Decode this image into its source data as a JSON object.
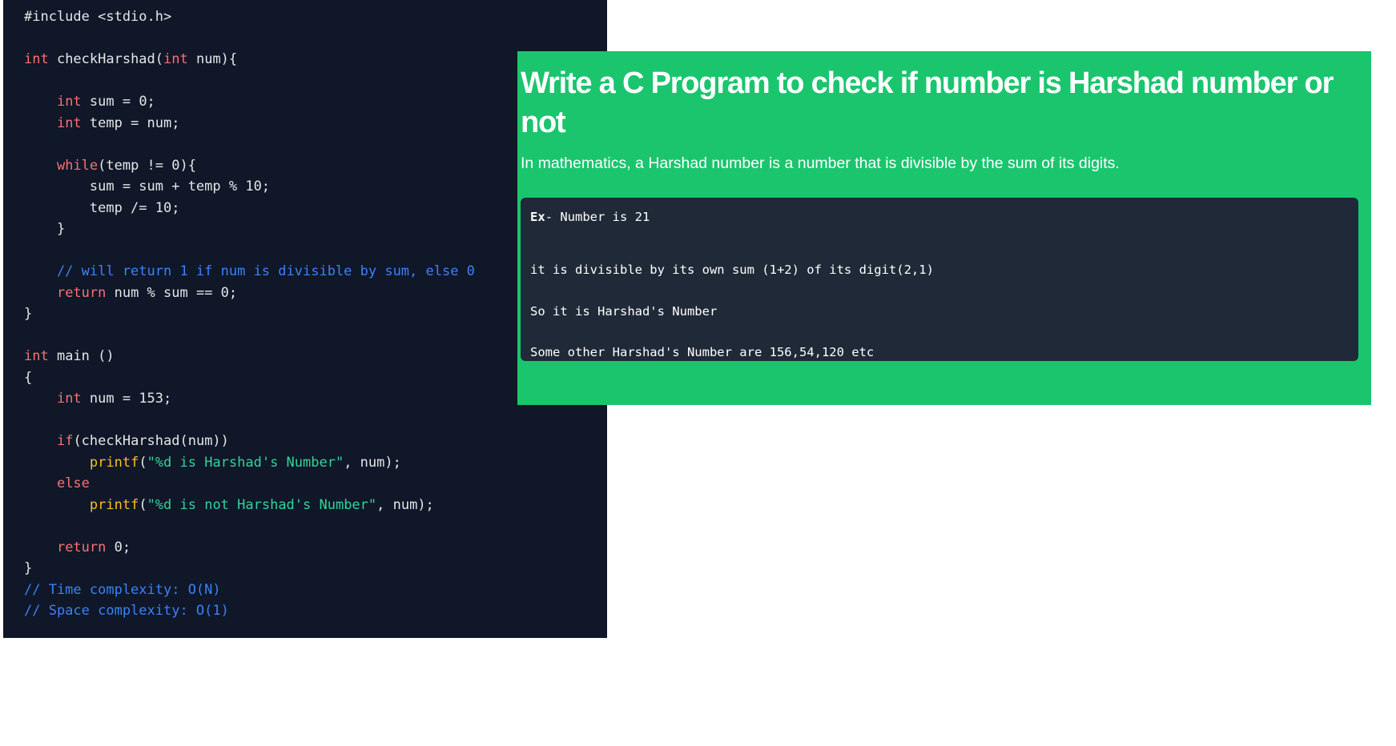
{
  "code": {
    "lines": [
      [
        {
          "t": "#include <stdio.h>",
          "c": "plain"
        }
      ],
      [],
      [
        {
          "t": "int",
          "c": "keyword"
        },
        {
          "t": " checkHarshad(",
          "c": "plain"
        },
        {
          "t": "int",
          "c": "keyword"
        },
        {
          "t": " num){",
          "c": "plain"
        }
      ],
      [],
      [
        {
          "t": "    ",
          "c": "plain"
        },
        {
          "t": "int",
          "c": "keyword"
        },
        {
          "t": " sum = 0;",
          "c": "plain"
        }
      ],
      [
        {
          "t": "    ",
          "c": "plain"
        },
        {
          "t": "int",
          "c": "keyword"
        },
        {
          "t": " temp = num;",
          "c": "plain"
        }
      ],
      [],
      [
        {
          "t": "    ",
          "c": "plain"
        },
        {
          "t": "while",
          "c": "keyword"
        },
        {
          "t": "(temp != 0){",
          "c": "plain"
        }
      ],
      [
        {
          "t": "        sum = sum + temp % 10;",
          "c": "plain"
        }
      ],
      [
        {
          "t": "        temp /= 10;",
          "c": "plain"
        }
      ],
      [
        {
          "t": "    }",
          "c": "plain"
        }
      ],
      [],
      [
        {
          "t": "    // will return 1 if num is divisible by sum, else 0",
          "c": "comment"
        }
      ],
      [
        {
          "t": "    ",
          "c": "plain"
        },
        {
          "t": "return",
          "c": "keyword"
        },
        {
          "t": " num % sum == 0;",
          "c": "plain"
        }
      ],
      [
        {
          "t": "}",
          "c": "plain"
        }
      ],
      [],
      [
        {
          "t": "int",
          "c": "keyword"
        },
        {
          "t": " main ()",
          "c": "plain"
        }
      ],
      [
        {
          "t": "{",
          "c": "plain"
        }
      ],
      [
        {
          "t": "    ",
          "c": "plain"
        },
        {
          "t": "int",
          "c": "keyword"
        },
        {
          "t": " num = 153;",
          "c": "plain"
        }
      ],
      [],
      [
        {
          "t": "    ",
          "c": "plain"
        },
        {
          "t": "if",
          "c": "keyword"
        },
        {
          "t": "(checkHarshad(num))",
          "c": "plain"
        }
      ],
      [
        {
          "t": "        ",
          "c": "plain"
        },
        {
          "t": "printf",
          "c": "func"
        },
        {
          "t": "(",
          "c": "plain"
        },
        {
          "t": "\"%d is Harshad's Number\"",
          "c": "string"
        },
        {
          "t": ", num);",
          "c": "plain"
        }
      ],
      [
        {
          "t": "    ",
          "c": "plain"
        },
        {
          "t": "else",
          "c": "keyword"
        }
      ],
      [
        {
          "t": "        ",
          "c": "plain"
        },
        {
          "t": "printf",
          "c": "func"
        },
        {
          "t": "(",
          "c": "plain"
        },
        {
          "t": "\"%d is not Harshad's Number\"",
          "c": "string"
        },
        {
          "t": ", num);",
          "c": "plain"
        }
      ],
      [],
      [
        {
          "t": "    ",
          "c": "plain"
        },
        {
          "t": "return",
          "c": "keyword"
        },
        {
          "t": " 0;",
          "c": "plain"
        }
      ],
      [
        {
          "t": "}",
          "c": "plain"
        }
      ],
      [
        {
          "t": "// Time complexity: O(N)",
          "c": "comment"
        }
      ],
      [
        {
          "t": "// Space complexity: O(1)",
          "c": "comment"
        }
      ]
    ]
  },
  "article": {
    "title": "Write a C Program to check if number is Harshad number or not",
    "intro": "In mathematics, a Harshad number is a number that is divisible by the sum of its digits.",
    "example": {
      "prefix": "Ex",
      "line1_rest": "- Number is 21",
      "line2": "it is divisible by its own sum (1+2) of its digit(2,1)",
      "line3": "So it is Harshad's Number",
      "line4": "Some other Harshad's Number are 156,54,120 etc"
    }
  },
  "colors": {
    "code_background": "#0f1729",
    "keyword": "#f87171",
    "function": "#fbbf24",
    "string": "#34d399",
    "comment": "#3b82f6",
    "article_background": "#1ac56e",
    "example_background": "#1f2937"
  }
}
